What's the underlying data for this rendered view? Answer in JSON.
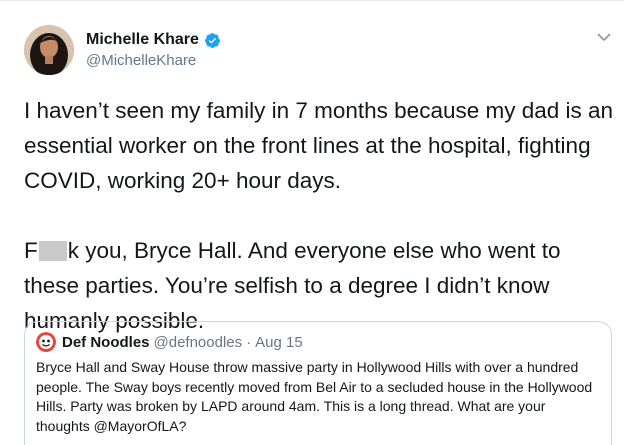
{
  "author": {
    "display_name": "Michelle Khare",
    "handle": "@MichelleKhare",
    "verified": true
  },
  "icons": {
    "verified": "verified-badge-icon",
    "caret": "chevron-down-icon"
  },
  "tweet": {
    "line1": "I haven’t seen my family in 7 months because my dad is an essential worker on the front lines at the hospital, fighting COVID, working 20+ hour days.",
    "line2_prefix": "F",
    "line2_suffix": "k you, Bryce Hall. And everyone else who went to these parties. You’re selfish to a degree I didn’t know humanly possible."
  },
  "quoted_tweet": {
    "display_name": "Def Noodles",
    "handle": "@defnoodles",
    "separator": "·",
    "date": "Aug 15",
    "text": "Bryce Hall and Sway House throw massive party in Hollywood Hills with over a hundred people. The Sway boys recently moved from Bel Air to a secluded house in the Hollywood Hills. Party was broken by LAPD around 4am. This is a long thread. What are your thoughts @MayorOfLA?"
  },
  "colors": {
    "text": "#14171a",
    "secondary": "#657786",
    "verified": "#1da1f2",
    "border": "#ccd6dd"
  }
}
